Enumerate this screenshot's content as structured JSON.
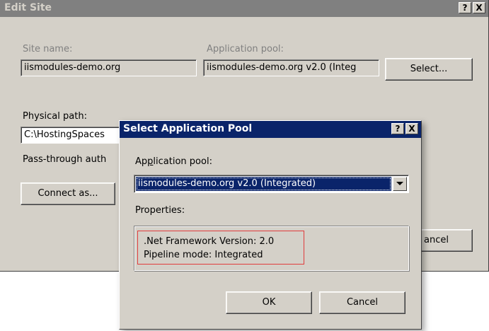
{
  "edit_site": {
    "title": "Edit Site",
    "help_btn": "?",
    "close_btn": "X",
    "site_name_label": "Site name:",
    "site_name_value": "iismodules-demo.org",
    "app_pool_label": "Application pool:",
    "app_pool_value": "iismodules-demo.org v2.0 (Integ",
    "select_button": "Select...",
    "physical_path_label": "Physical path:",
    "physical_path_value": "C:\\HostingSpaces",
    "pass_through_label": "Pass-through auth",
    "connect_as_button": "Connect as...",
    "cancel_partial": "ancel"
  },
  "select_pool": {
    "title": "Select Application Pool",
    "help_btn": "?",
    "close_btn": "X",
    "app_pool_label_pre": "Ap",
    "app_pool_label_accel": "p",
    "app_pool_label_post": "lication pool:",
    "dropdown_value": "iismodules-demo.org v2.0 (Integrated)",
    "properties_label": "Properties:",
    "framework_version": ".Net Framework Version: 2.0",
    "pipeline_mode": "Pipeline mode: Integrated",
    "ok_button": "OK",
    "cancel_button": "Cancel"
  },
  "colors": {
    "inactive_title": "#808080",
    "active_title": "#0a246a",
    "highlight": "#e03c3c"
  }
}
